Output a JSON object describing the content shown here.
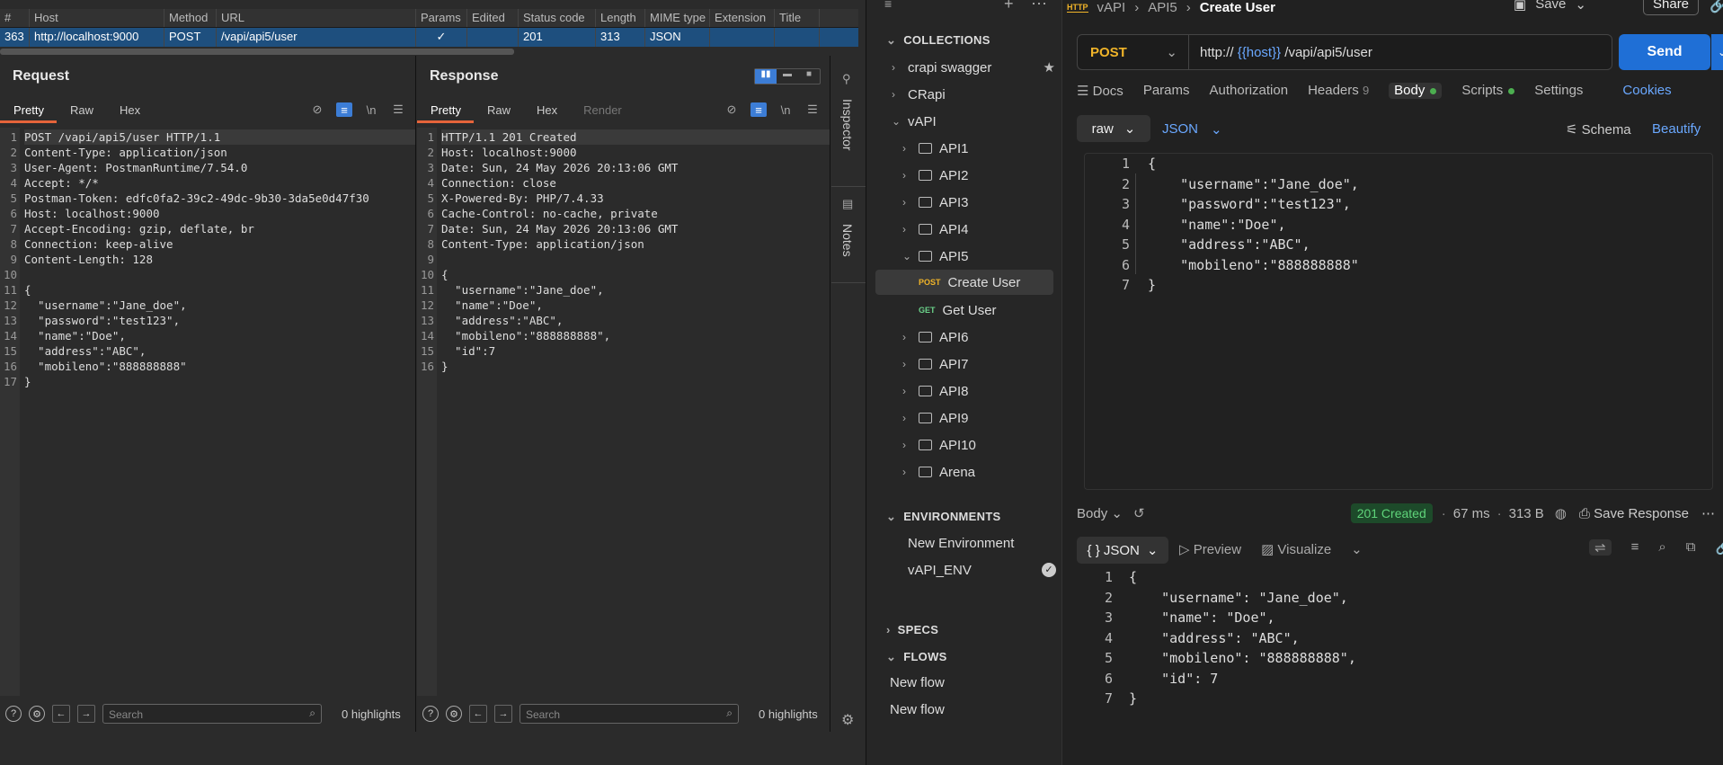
{
  "burp": {
    "table": {
      "headers": [
        "#",
        "Host",
        "Method",
        "URL",
        "Params",
        "Edited",
        "Status code",
        "Length",
        "MIME type",
        "Extension",
        "Title"
      ],
      "row": {
        "num": "363",
        "host": "http://localhost:9000",
        "method": "POST",
        "url": "/vapi/api5/user",
        "params": "✓",
        "edited": "",
        "status": "201",
        "length": "313",
        "mime": "JSON",
        "extension": "",
        "title": ""
      }
    },
    "request": {
      "title": "Request",
      "tabs": [
        "Pretty",
        "Raw",
        "Hex"
      ],
      "lines": [
        "POST /vapi/api5/user HTTP/1.1",
        "Content-Type: application/json",
        "User-Agent: PostmanRuntime/7.54.0",
        "Accept: */*",
        "Postman-Token: edfc0fa2-39c2-49dc-9b30-3da5e0d47f30",
        "Host: localhost:9000",
        "Accept-Encoding: gzip, deflate, br",
        "Connection: keep-alive",
        "Content-Length: 128",
        "",
        "{",
        "  \"username\":\"Jane_doe\",",
        "  \"password\":\"test123\",",
        "  \"name\":\"Doe\",",
        "  \"address\":\"ABC\",",
        "  \"mobileno\":\"888888888\"",
        "}"
      ],
      "search_placeholder": "Search",
      "highlights": "0 highlights"
    },
    "response": {
      "title": "Response",
      "tabs": [
        "Pretty",
        "Raw",
        "Hex",
        "Render"
      ],
      "lines": [
        "HTTP/1.1 201 Created",
        "Host: localhost:9000",
        "Date: Sun, 24 May 2026 20:13:06 GMT",
        "Connection: close",
        "X-Powered-By: PHP/7.4.33",
        "Cache-Control: no-cache, private",
        "Date: Sun, 24 May 2026 20:13:06 GMT",
        "Content-Type: application/json",
        "",
        "{",
        "  \"username\":\"Jane_doe\",",
        "  \"name\":\"Doe\",",
        "  \"address\":\"ABC\",",
        "  \"mobileno\":\"888888888\",",
        "  \"id\":7",
        "}"
      ],
      "search_placeholder": "Search",
      "highlights": "0 highlights"
    },
    "side_tabs": [
      "Inspector",
      "Notes"
    ]
  },
  "postman": {
    "sections": {
      "collections": "COLLECTIONS",
      "environments": "ENVIRONMENTS",
      "specs": "SPECS",
      "flows": "FLOWS"
    },
    "collections": [
      "crapi swagger",
      "CRapi",
      "vAPI"
    ],
    "folders": [
      "API1",
      "API2",
      "API3",
      "API4",
      "API5",
      "API6",
      "API7",
      "API8",
      "API9",
      "API10",
      "Arena"
    ],
    "requests": [
      {
        "method": "POST",
        "name": "Create User"
      },
      {
        "method": "GET",
        "name": "Get User"
      }
    ],
    "environments": [
      "New Environment",
      "vAPI_ENV"
    ],
    "flows": [
      "New flow",
      "New flow"
    ],
    "breadcrumb": {
      "app_icon": "HTTP",
      "parts": [
        "vAPI",
        "API5"
      ],
      "current": "Create User"
    },
    "top_actions": {
      "save": "Save",
      "share": "Share"
    },
    "method": "POST",
    "url_prefix": "http://",
    "url_var": "{{host}}",
    "url_path": "/vapi/api5/user",
    "send": "Send",
    "req_tabs": [
      "Docs",
      "Params",
      "Authorization",
      "Headers",
      "Body",
      "Scripts",
      "Settings"
    ],
    "headers_count": "9",
    "cookies": "Cookies",
    "body_mode": "raw",
    "body_format": "JSON",
    "schema": "Schema",
    "beautify": "Beautify",
    "body_lines": [
      "{",
      "    \"username\":\"Jane_doe\",",
      "    \"password\":\"test123\",",
      "    \"name\":\"Doe\",",
      "    \"address\":\"ABC\",",
      "    \"mobileno\":\"888888888\"",
      "}"
    ],
    "response_bar": {
      "body": "Body",
      "status": "201 Created",
      "time": "67 ms",
      "size": "313 B",
      "save_response": "Save Response"
    },
    "response_views": {
      "json": "{ } JSON",
      "preview": "Preview",
      "visualize": "Visualize"
    },
    "response_lines": [
      "{",
      "    \"username\": \"Jane_doe\",",
      "    \"name\": \"Doe\",",
      "    \"address\": \"ABC\",",
      "    \"mobileno\": \"888888888\",",
      "    \"id\": 7",
      "}"
    ],
    "colors": {
      "accent": "#1f6fd6",
      "method_post": "#f0b429",
      "status_ok": "#5fd47a",
      "burp_orange": "#e5643a"
    }
  }
}
